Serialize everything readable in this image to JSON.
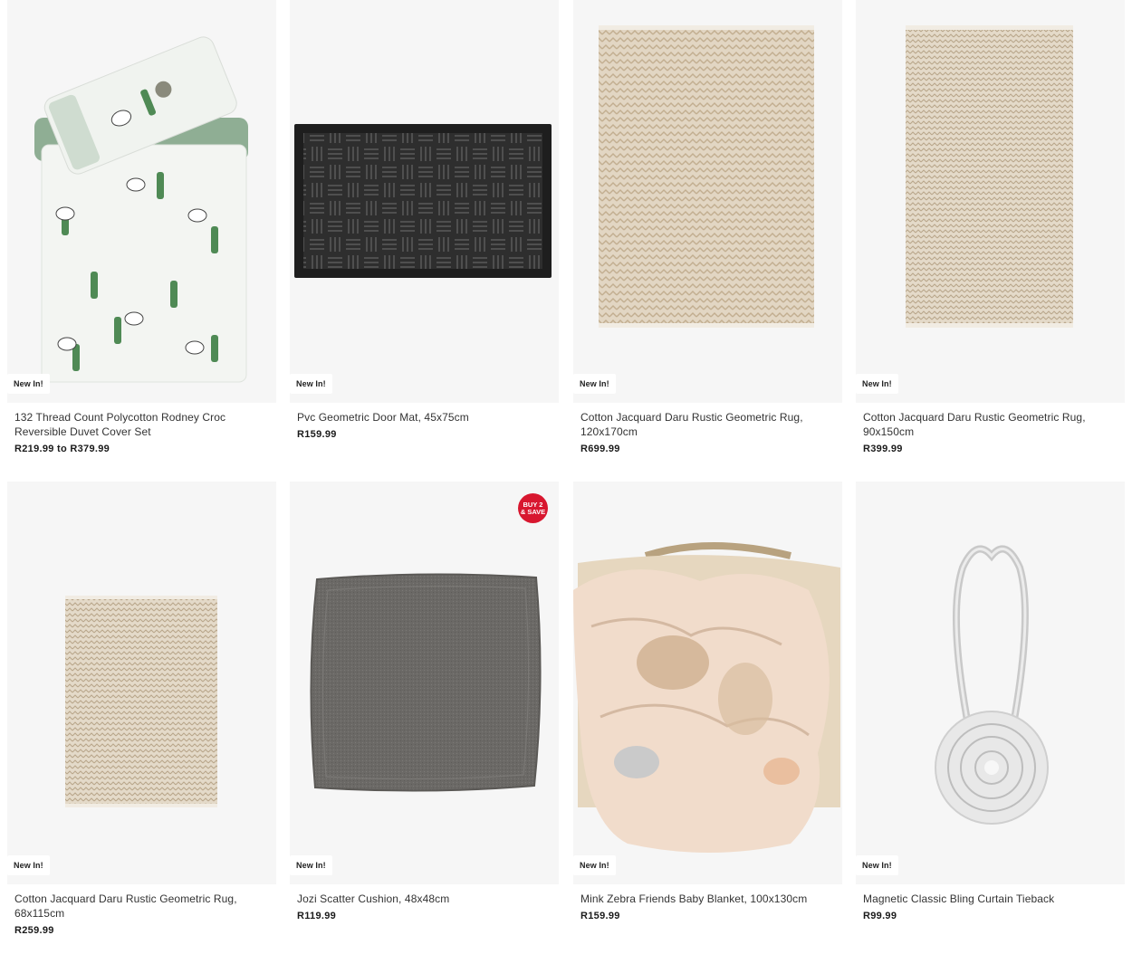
{
  "products": [
    {
      "title": "132 Thread Count Polycotton Rodney Croc Reversible Duvet Cover Set",
      "price": "R219.99 to R379.99",
      "badge": "New In!",
      "image_icon": "duvet-cover-image"
    },
    {
      "title": "Pvc Geometric Door Mat, 45x75cm",
      "price": "R159.99",
      "badge": "New In!",
      "image_icon": "door-mat-image"
    },
    {
      "title": "Cotton Jacquard Daru Rustic Geometric Rug, 120x170cm",
      "price": "R699.99",
      "badge": "New In!",
      "image_icon": "rug-image"
    },
    {
      "title": "Cotton Jacquard Daru Rustic Geometric Rug, 90x150cm",
      "price": "R399.99",
      "badge": "New In!",
      "image_icon": "rug-image"
    },
    {
      "title": "Cotton Jacquard Daru Rustic Geometric Rug, 68x115cm",
      "price": "R259.99",
      "badge": "New In!",
      "image_icon": "rug-image"
    },
    {
      "title": "Jozi Scatter Cushion, 48x48cm",
      "price": "R119.99",
      "badge": "New In!",
      "promo": "BUY 2 & SAVE",
      "image_icon": "cushion-image"
    },
    {
      "title": "Mink Zebra Friends Baby Blanket, 100x130cm",
      "price": "R159.99",
      "badge": "New In!",
      "image_icon": "baby-blanket-image"
    },
    {
      "title": "Magnetic Classic Bling Curtain Tieback",
      "price": "R99.99",
      "badge": "New In!",
      "image_icon": "curtain-tieback-image"
    }
  ],
  "colors": {
    "promo_red": "#d8172f",
    "card_bg": "#f6f6f6"
  }
}
